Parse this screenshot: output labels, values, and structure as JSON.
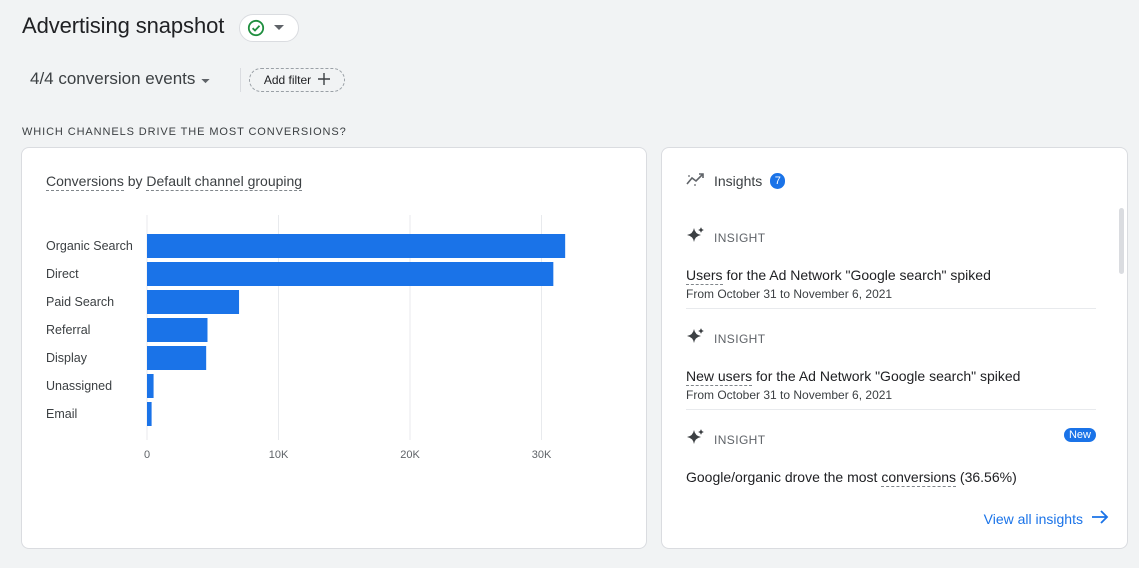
{
  "header": {
    "title": "Advertising snapshot",
    "conversion_select": "4/4 conversion events",
    "add_filter_label": "Add filter"
  },
  "section_heading": "WHICH CHANNELS DRIVE THE MOST CONVERSIONS?",
  "chart_card": {
    "title_part1": "Conversions",
    "title_mid": " by ",
    "title_part2": "Default channel grouping"
  },
  "chart_data": {
    "type": "bar",
    "orientation": "horizontal",
    "categories": [
      "Organic Search",
      "Direct",
      "Paid Search",
      "Referral",
      "Display",
      "Unassigned",
      "Email"
    ],
    "values": [
      31800,
      30900,
      7000,
      4600,
      4500,
      500,
      350
    ],
    "xlim": [
      0,
      30000
    ],
    "xticks": [
      0,
      10000,
      20000,
      30000
    ],
    "xtick_labels": [
      "0",
      "10K",
      "20K",
      "30K"
    ],
    "grid": "vertical",
    "color": "#1a73e8"
  },
  "insights": {
    "header_label": "Insights",
    "count": "7",
    "items": [
      {
        "label": "INSIGHT",
        "title_linked": "Users",
        "title_rest": " for the Ad Network \"Google search\" spiked",
        "date": "From October 31 to November 6, 2021"
      },
      {
        "label": "INSIGHT",
        "title_linked": "New users",
        "title_rest": " for the Ad Network \"Google search\" spiked",
        "date": "From October 31 to November 6, 2021"
      },
      {
        "label": "INSIGHT",
        "badge": "New",
        "title_pre": "Google/organic drove the most ",
        "title_linked": "conversions",
        "title_post": " (36.56%)"
      }
    ],
    "view_all_label": "View all insights"
  },
  "colors": {
    "accent": "#1a73e8",
    "status_ok": "#1e8e3e"
  }
}
